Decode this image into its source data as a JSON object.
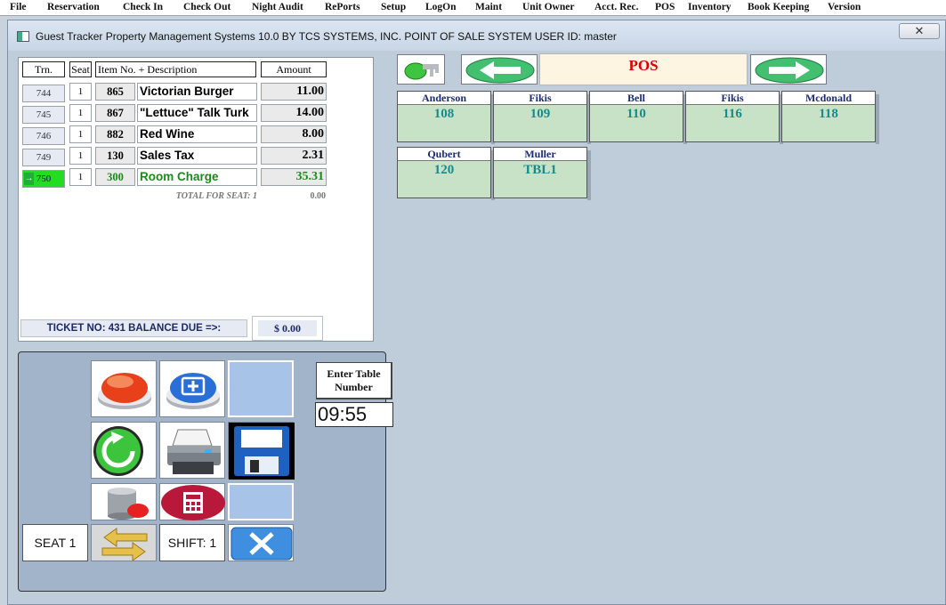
{
  "menu": [
    "File",
    "Reservation",
    "Check In",
    "Check Out",
    "Night Audit",
    "RePorts",
    "Setup",
    "LogOn",
    "Maint",
    "Unit Owner",
    "Acct. Rec.",
    "POS",
    "Inventory",
    "Book Keeping",
    "Version"
  ],
  "window": {
    "title": "Guest Tracker Property Management Systems 10.0 BY TCS SYSTEMS, INC.   POINT OF SALE SYSTEM    USER ID: master",
    "close_glyph": "✕"
  },
  "ticket": {
    "headers": {
      "trn": "Trn.",
      "seat": "Seat",
      "item": "Item No. + Description",
      "amount": "Amount"
    },
    "rows": [
      {
        "trn": "744",
        "seat": "1",
        "item": "865",
        "desc": "Victorian Burger",
        "amount": "11.00"
      },
      {
        "trn": "745",
        "seat": "1",
        "item": "867",
        "desc": "\"Lettuce\" Talk Turk",
        "amount": "14.00"
      },
      {
        "trn": "746",
        "seat": "1",
        "item": "882",
        "desc": "Red Wine",
        "amount": "8.00"
      },
      {
        "trn": "749",
        "seat": "1",
        "item": "130",
        "desc": "Sales Tax",
        "amount": "2.31"
      },
      {
        "trn": "750",
        "seat": "1",
        "item": "300",
        "desc": "Room Charge",
        "amount": "35.31"
      }
    ],
    "total_label": "TOTAL FOR SEAT: 1",
    "total_value": "0.00",
    "footer_text": "TICKET NO: 431     BALANCE DUE =>:",
    "balance": "$ 0.00"
  },
  "buttons": {
    "enter_table": "Enter Table Number",
    "clock": "09:55",
    "seat": "SEAT 1",
    "shift": "SHIFT: 1"
  },
  "pos": {
    "label": "POS"
  },
  "rooms": [
    {
      "name": "Anderson",
      "number": "108"
    },
    {
      "name": "Fikis",
      "number": "109"
    },
    {
      "name": "Bell",
      "number": "110"
    },
    {
      "name": "Fikis",
      "number": "116"
    },
    {
      "name": "Mcdonald",
      "number": "118"
    },
    {
      "name": "Qubert",
      "number": "120"
    },
    {
      "name": "Muller",
      "number": "TBL1"
    }
  ],
  "colors": {
    "room_bg": "#c7e2c7",
    "pos_label": "#dd0000",
    "selected_trn": "#22dd22",
    "panel_bg": "#a2b4c9"
  }
}
